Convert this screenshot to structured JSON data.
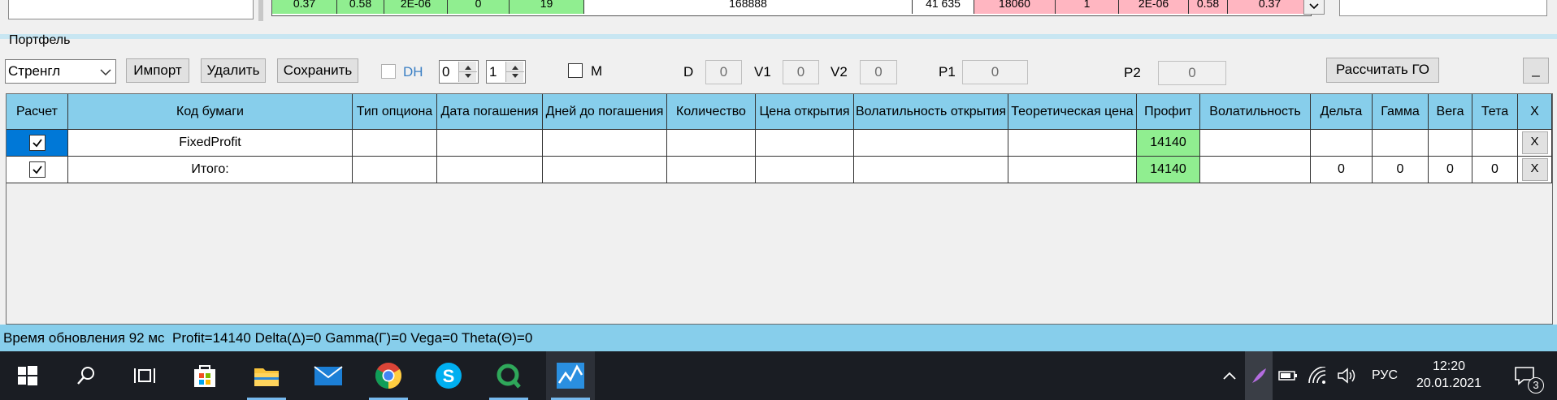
{
  "top_strip": {
    "row_values": [
      "0.37",
      "0.58",
      "2E-06",
      "0",
      "19",
      "168888",
      "41 635",
      "18060",
      "1",
      "2E-06",
      "0.58",
      "0.37"
    ]
  },
  "portfolio": {
    "group_label": "Портфель",
    "strategy_select": "Стренгл",
    "import_label": "Импорт",
    "delete_label": "Удалить",
    "save_label": "Сохранить",
    "dh_label": "DH",
    "spin1_value": "0",
    "spin2_value": "1",
    "m_label": "M",
    "d_label": "D",
    "d_value": "0",
    "v1_label": "V1",
    "v1_value": "0",
    "v2_label": "V2",
    "v2_value": "0",
    "p1_label": "P1",
    "p1_value": "0",
    "p2_label": "P2",
    "p2_value": "0",
    "calc_label": "Рассчитать ГО",
    "minimize_label": "_"
  },
  "grid": {
    "headers": [
      "Расчет",
      "Код бумаги",
      "Тип опциона",
      "Дата погашения",
      "Дней до погашения",
      "Количество",
      "Цена открытия",
      "Волатильность открытия",
      "Теоретическая цена",
      "Профит",
      "Волатильность",
      "Дельта",
      "Гамма",
      "Вега",
      "Тета",
      "X"
    ],
    "rows": [
      {
        "name": "FixedProfit",
        "profit": "14140",
        "delta": "",
        "gamma": "",
        "vega": "",
        "theta": "",
        "x": "X"
      },
      {
        "name": "Итого:",
        "profit": "14140",
        "delta": "0",
        "gamma": "0",
        "vega": "0",
        "theta": "0",
        "x": "X"
      }
    ]
  },
  "status": {
    "text": "Время обновления 92 мс  Profit=14140 Delta(Δ)=0 Gamma(Γ)=0 Vega=0 Theta(Θ)=0"
  },
  "taskbar": {
    "language": "РУС",
    "time": "12:20",
    "date": "20.01.2021",
    "notification_count": "3"
  },
  "colors": {
    "header_blue": "#87ceeb",
    "profit_green": "#90ee90",
    "selection_blue": "#0078d7",
    "taskbar": "#1a1d23"
  }
}
